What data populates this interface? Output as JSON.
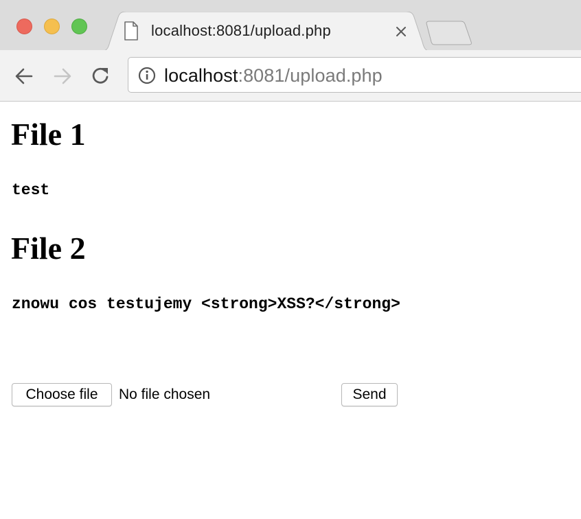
{
  "browser": {
    "tab": {
      "title": "localhost:8081/upload.php"
    },
    "address_bar": {
      "host": "localhost",
      "rest": ":8081/upload.php"
    }
  },
  "page": {
    "file1": {
      "heading": "File 1",
      "content": "test"
    },
    "file2": {
      "heading": "File 2",
      "content": "znowu cos testujemy <strong>XSS?</strong>"
    },
    "form": {
      "choose_file_label": "Choose file",
      "no_file_text": "No file chosen",
      "send_label": "Send"
    }
  },
  "colors": {
    "titlebar": "#dcdcdc",
    "toolbar": "#f2f2f2",
    "traffic_close": "#ed6a5e",
    "traffic_minimize": "#f5bf4f",
    "traffic_maximize": "#61c554"
  },
  "icons": {
    "tab_favicon": "document-icon",
    "tab_close": "close-icon",
    "back": "arrow-left-icon",
    "forward": "arrow-right-icon",
    "reload": "reload-icon",
    "site_info": "info-icon"
  }
}
